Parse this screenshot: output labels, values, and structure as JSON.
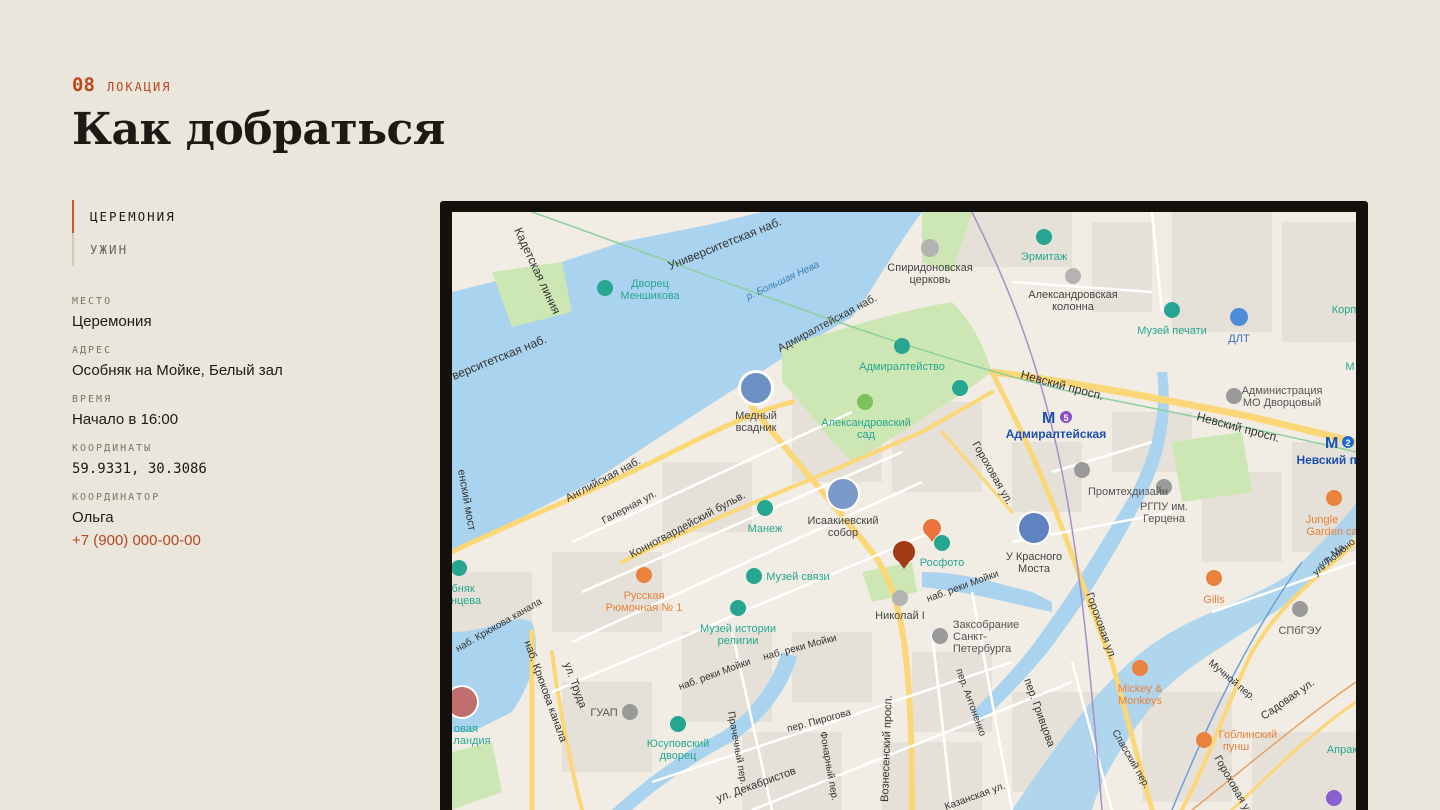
{
  "section": {
    "number": "08",
    "label": "ЛОКАЦИЯ",
    "title": "Как добраться"
  },
  "tabs": [
    {
      "label": "ЦЕРЕМОНИЯ",
      "active": true
    },
    {
      "label": "УЖИН",
      "active": false
    }
  ],
  "details": {
    "place_label": "МЕСТО",
    "place": "Церемония",
    "address_label": "АДРЕС",
    "address": "Особняк на Мойке, Белый зал",
    "time_label": "ВРЕМЯ",
    "time": "Начало в 16:00",
    "coords_label": "КООРДИНАТЫ",
    "coords": "59.9331, 30.3086",
    "coordinator_label": "КООРДИНАТОР",
    "coordinator": "Ольга",
    "phone": "+7 (900) 000-00-00"
  },
  "map": {
    "colors": {
      "water": "#a9d3ee",
      "park": "#cde7b4",
      "block": "#e6e1d8",
      "road_major": "#fbd777",
      "accent": "#c85a2b",
      "marker_main": "#a23a14",
      "marker_secondary": "#e9753c",
      "museum": "#26a691",
      "metro": "#1b4fb4"
    },
    "labels": {
      "kadetskaya": "Кадетская линия",
      "universitetskaya": "Университетская наб.",
      "universitetskaya2": "верситетская наб.",
      "bolshaya_neva": "р. Большая Нева",
      "menshikov_1": "Дворец",
      "menshikov_2": "Меншикова",
      "spiridon_1": "Спиридоновская",
      "spiridon_2": "церковь",
      "hermitage": "Эрмитаж",
      "alexcol_1": "Александровская",
      "alexcol_2": "колонна",
      "museum_press": "Музей печати",
      "dlt": "ДЛТ",
      "korp": "Корп",
      "admiralteyskaya_nab": "Адмиралтейская наб.",
      "admiralty": "Адмиралтейство",
      "nevsky1": "Невский просп.",
      "nevsky2": "Невский просп.",
      "admin_1": "Администрация",
      "admin_2": "МО Дворцовый",
      "m_letter": "М",
      "bronze_1": "Медный",
      "bronze_2": "всадник",
      "alexgarden_1": "Александровский",
      "alexgarden_2": "сад",
      "metro_admiralteyskaya": "Адмиралтейская",
      "metro_line_5": "5",
      "metro_nevsky": "Невский пр.",
      "metro_line_2": "2",
      "angliyskaya": "Английская наб.",
      "galernaya": "Галерная ул.",
      "gorokhovaya1": "Гороховая ул.",
      "promtech": "Промтехдизайн",
      "ranepa_1": "РГПУ им.",
      "ranepa_2": "Герцена",
      "jungle_1": "Jungle",
      "jungle_2": "Garden ca",
      "konnogv": "Конногвардейский бульв.",
      "manege": "Манеж",
      "isaac_1": "Исаакиевский",
      "isaac_2": "собор",
      "rosphoto": "Росфото",
      "krasny_1": "У Красного",
      "krasny_2": "Моста",
      "blagov": "енский мост",
      "osobnyak_1": "обняк",
      "osobnyak_2": "нцева",
      "russkaya_1": "Русская",
      "russkaya_2": "Рюмочная № 1",
      "museum_svyazi": "Музей связи",
      "nab_moyki1": "наб. реки Мойки",
      "gills": "Gills",
      "lomonosova": "ул. Ломоно",
      "krukova1": "наб. Крюкова канала",
      "museum_religion_1": "Музей истории",
      "museum_religion_2": "религии",
      "nikolai": "Николай I",
      "zaksob_1": "Заксобрание",
      "zaksob_2": "Санкт-",
      "zaksob_3": "Петербурга",
      "spbgeu": "СПбГЭУ",
      "nab_moyki2": "наб. реки Мойки",
      "truda": "ул. Труда",
      "krukova2": "наб. Крюкова канала",
      "guap": "ГУАП",
      "nab_moyki3": "наб. реки Мойки",
      "antonenko": "пер. Антоненко",
      "grivtsova": "пер. Гривцова",
      "gorokhovaya2": "Гороховая ул.",
      "mickey_1": "Mickey &",
      "mickey_2": "Monkeys",
      "muchnoy": "Мучной пер.",
      "sadovaya": "Садовая ул.",
      "novaya_1": "овая",
      "novaya_2": "ландия",
      "yusupov_1": "Юсуповский",
      "yusupov_2": "дворец",
      "prachechny": "Прачечный пер.",
      "pirogova": "пер. Пирогова",
      "voznesensky": "Вознесенский просп.",
      "dekabristov": "ул. Декабристов",
      "fonarny": "Фонарный пер.",
      "kazanskaya": "Казанская ул.",
      "spassky": "Спасский пер.",
      "goblin_1": "Гоблинский",
      "goblin_2": "пунш",
      "gorokhovaya3": "Гороховая ул.",
      "aprak": "Апрак",
      "ul_ma": "ул. Ма",
      "muz_m": "М"
    }
  }
}
